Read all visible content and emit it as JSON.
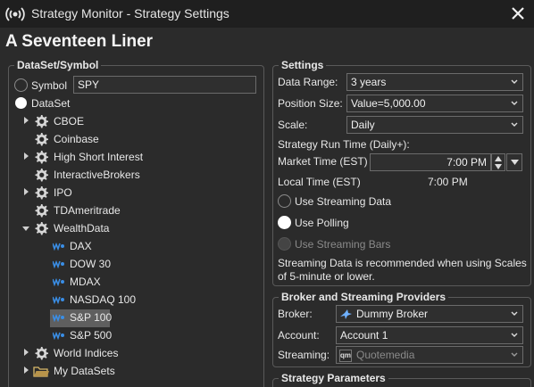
{
  "window": {
    "title": "Strategy Monitor - Strategy Settings",
    "app_icon": "broadcast-icon",
    "close_icon": "close-icon"
  },
  "strategy": {
    "name": "A Seventeen Liner"
  },
  "dataset_group": {
    "title": "DataSet/Symbol",
    "symbol_label": "Symbol",
    "symbol_value": "SPY",
    "dataset_label": "DataSet",
    "selected_mode": "DataSet",
    "tree": [
      {
        "label": "CBOE",
        "icon": "gear-icon",
        "expander": "collapsed"
      },
      {
        "label": "Coinbase",
        "icon": "gear-icon",
        "expander": "none"
      },
      {
        "label": "High Short Interest",
        "icon": "gear-icon",
        "expander": "collapsed"
      },
      {
        "label": "InteractiveBrokers",
        "icon": "gear-icon",
        "expander": "none"
      },
      {
        "label": "IPO",
        "icon": "gear-icon",
        "expander": "collapsed"
      },
      {
        "label": "TDAmeritrade",
        "icon": "gear-icon",
        "expander": "none"
      },
      {
        "label": "WealthData",
        "icon": "gear-icon",
        "expander": "expanded"
      },
      {
        "label": "DAX",
        "icon": "wealthdata-icon",
        "child": true
      },
      {
        "label": "DOW 30",
        "icon": "wealthdata-icon",
        "child": true
      },
      {
        "label": "MDAX",
        "icon": "wealthdata-icon",
        "child": true
      },
      {
        "label": "NASDAQ 100",
        "icon": "wealthdata-icon",
        "child": true
      },
      {
        "label": "S&P 100",
        "icon": "wealthdata-icon",
        "child": true,
        "selected": true
      },
      {
        "label": "S&P 500",
        "icon": "wealthdata-icon",
        "child": true
      },
      {
        "label": "World Indices",
        "icon": "gear-icon",
        "expander": "collapsed"
      },
      {
        "label": "My DataSets",
        "icon": "folder-icon",
        "expander": "collapsed"
      }
    ]
  },
  "settings": {
    "title": "Settings",
    "data_range_label": "Data Range:",
    "data_range_value": "3 years",
    "position_size_label": "Position Size:",
    "position_size_value": "Value=5,000.00",
    "scale_label": "Scale:",
    "scale_value": "Daily",
    "run_time_label": "Strategy Run Time (Daily+):",
    "market_time_label": "Market Time (EST)",
    "market_time_value": "7:00 PM",
    "local_time_label": "Local Time (EST)",
    "local_time_value": "7:00 PM",
    "streaming_data_label": "Use Streaming Data",
    "polling_label": "Use Polling",
    "streaming_bars_label": "Use Streaming Bars",
    "selected_mode": "Use Polling",
    "note_line1": "Streaming Data is recommended when using Scales",
    "note_line2": "of 5-minute or lower."
  },
  "broker": {
    "title": "Broker and Streaming Providers",
    "broker_label": "Broker:",
    "broker_value": "Dummy Broker",
    "account_label": "Account:",
    "account_value": "Account 1",
    "streaming_label": "Streaming:",
    "streaming_value": "Quotemedia",
    "streaming_badge": "qm"
  },
  "params": {
    "title": "Strategy Parameters"
  },
  "colors": {
    "background": "#2b2b2b",
    "titlebar": "#1f1f1f",
    "selection": "#5f5f5f",
    "wealthdata_icon": "#3a8ee6"
  }
}
